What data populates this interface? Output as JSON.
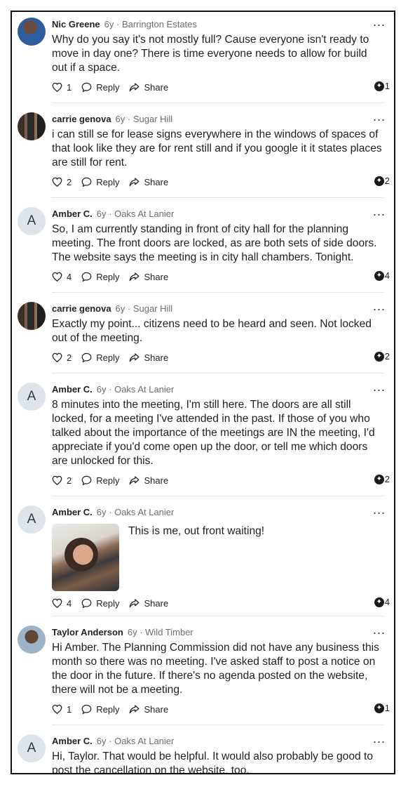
{
  "labels": {
    "reply": "Reply",
    "share": "Share",
    "more": "..."
  },
  "comments": [
    {
      "author": "Nic Greene",
      "meta": "6y · Barrington Estates",
      "avatar": "photo",
      "text": "Why do you say it's not mostly full? Cause everyone isn't ready to move in day one? There is time everyone needs to allow for build out if a space.",
      "likes": "1",
      "thanks": "1"
    },
    {
      "author": "carrie genova",
      "meta": "6y · Sugar Hill",
      "avatar": "photo",
      "text": "i can still se for lease signs everywhere in the windows of spaces of that look like they are for rent still and if you google it it states places are still for rent.",
      "likes": "2",
      "thanks": "2"
    },
    {
      "author": "Amber C.",
      "meta": "6y · Oaks At Lanier",
      "avatar": "A",
      "text": "So, I am currently standing in front of city hall for the planning meeting. The front doors are locked, as are both sets of side doors. The website says the meeting is in city hall chambers. Tonight.",
      "likes": "4",
      "thanks": "4"
    },
    {
      "author": "carrie genova",
      "meta": "6y · Sugar Hill",
      "avatar": "photo",
      "text": "Exactly my point... citizens need to be heard and seen. Not locked out of the meeting.",
      "likes": "2",
      "thanks": "2"
    },
    {
      "author": "Amber C.",
      "meta": "6y · Oaks At Lanier",
      "avatar": "A",
      "text": "8 minutes into the meeting, I'm still here. The doors are all still locked, for a meeting I've attended in the past. If those of you who talked about the importance of the meetings are IN the meeting, I'd appreciate if you'd come open up the door, or tell me which doors are unlocked for this.",
      "likes": "2",
      "thanks": "2"
    },
    {
      "author": "Amber C.",
      "meta": "6y · Oaks At Lanier",
      "avatar": "A",
      "text": "This is me, out front waiting!",
      "likes": "4",
      "thanks": "4"
    },
    {
      "author": "Taylor Anderson",
      "meta": "6y · Wild Timber",
      "avatar": "photo",
      "text": "Hi Amber. The Planning Commission did not have any business this month so there was no meeting. I've asked staff to post a notice on the door in the future. If there's no agenda posted on the website, there will not be a meeting.",
      "likes": "1",
      "thanks": "1"
    },
    {
      "author": "Amber C.",
      "meta": "6y · Oaks At Lanier",
      "avatar": "A",
      "text": "Hi, Taylor. That would be helpful. It would also probably be good to post the cancellation on the website, too.",
      "likes": "",
      "thanks": ""
    }
  ]
}
